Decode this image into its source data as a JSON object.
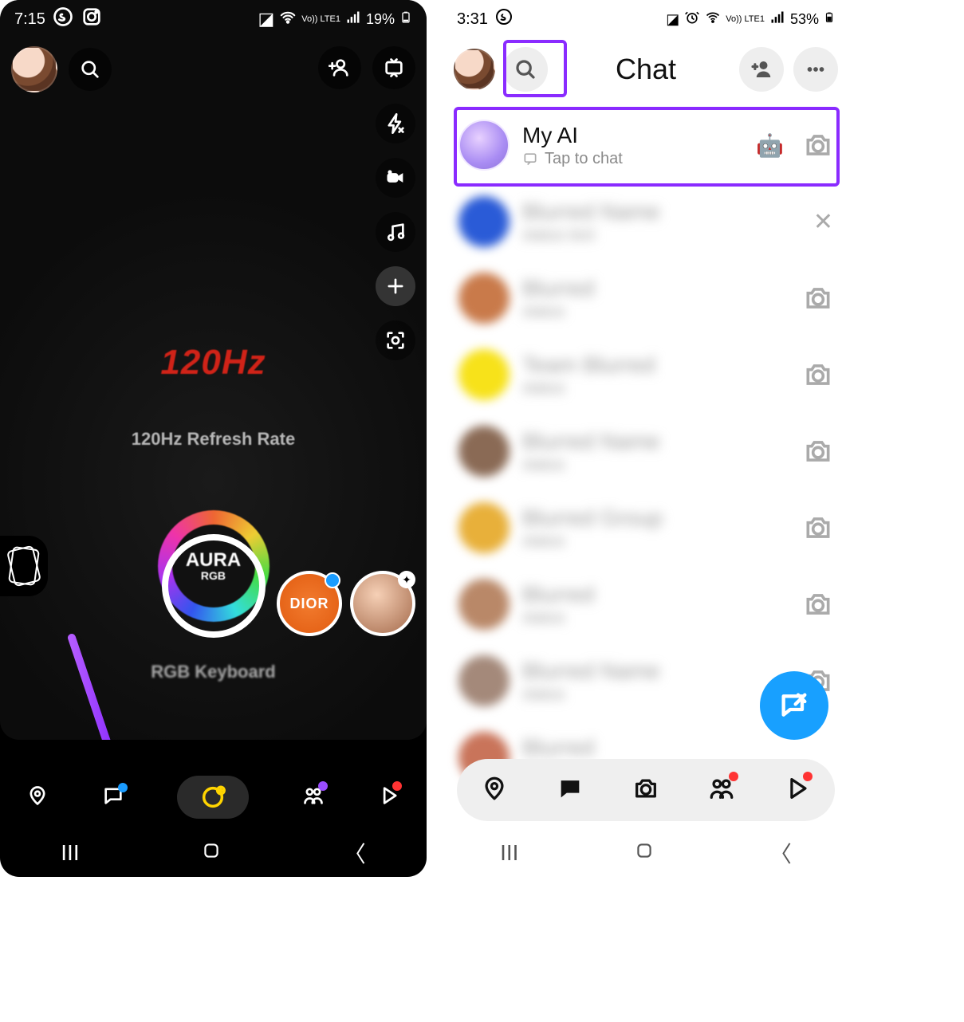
{
  "left": {
    "status": {
      "time": "7:15",
      "battery": "19%",
      "lte": "Vo)) LTE1"
    },
    "camera_text": {
      "hz": "120Hz",
      "refresh": "120Hz Refresh Rate",
      "aura_top": "AURA",
      "aura_sub": "RGB",
      "rgb": "RGB Keyboard"
    },
    "lens": {
      "dior": "DIOR"
    }
  },
  "right": {
    "status": {
      "time": "3:31",
      "battery": "53%",
      "lte": "Vo)) LTE1"
    },
    "header": {
      "title": "Chat"
    },
    "rows": {
      "myai": {
        "name": "My AI",
        "sub": "Tap to chat",
        "emoji": "🤖"
      }
    },
    "highlight_color": "#8a2bff"
  }
}
